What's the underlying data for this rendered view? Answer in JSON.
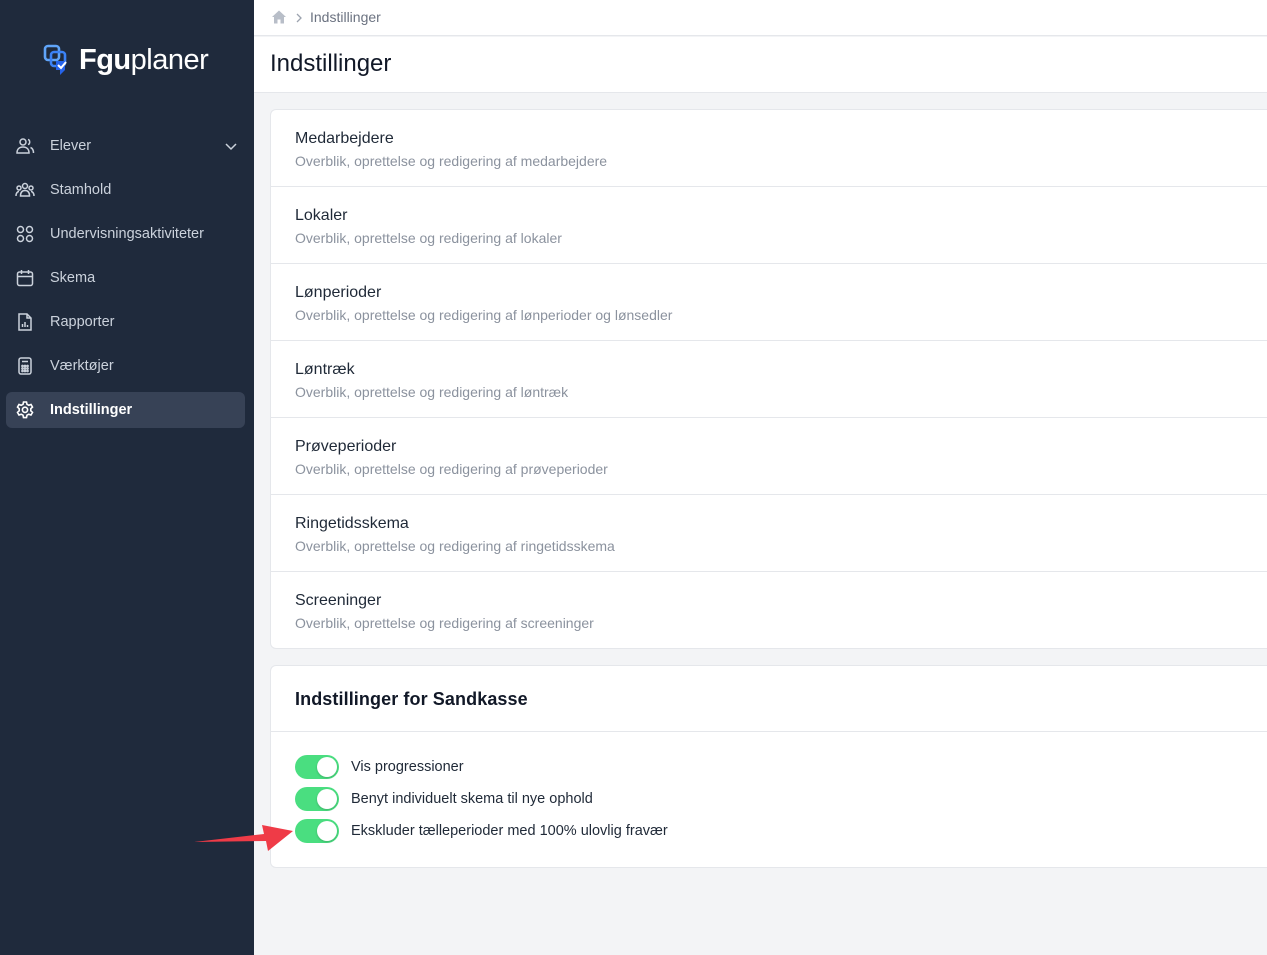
{
  "app": {
    "logo_bold": "Fgu",
    "logo_light": "planer",
    "brand_color": "#3b82f6"
  },
  "sidebar": {
    "items": [
      {
        "label": "Elever",
        "icon": "users-icon"
      },
      {
        "label": "Stamhold",
        "icon": "team-icon"
      },
      {
        "label": "Undervisningsaktiviteter",
        "icon": "grid-icon"
      },
      {
        "label": "Skema",
        "icon": "calendar-icon"
      },
      {
        "label": "Rapporter",
        "icon": "report-icon"
      },
      {
        "label": "Værktøjer",
        "icon": "calculator-icon"
      },
      {
        "label": "Indstillinger",
        "icon": "gear-icon",
        "active": true
      }
    ]
  },
  "breadcrumb": {
    "current": "Indstillinger"
  },
  "page": {
    "title": "Indstillinger"
  },
  "settings_list": [
    {
      "title": "Medarbejdere",
      "description": "Overblik, oprettelse og redigering af medarbejdere"
    },
    {
      "title": "Lokaler",
      "description": "Overblik, oprettelse og redigering af lokaler"
    },
    {
      "title": "Lønperioder",
      "description": "Overblik, oprettelse og redigering af lønperioder og lønsedler"
    },
    {
      "title": "Løntræk",
      "description": "Overblik, oprettelse og redigering af løntræk"
    },
    {
      "title": "Prøveperioder",
      "description": "Overblik, oprettelse og redigering af prøveperioder"
    },
    {
      "title": "Ringetidsskema",
      "description": "Overblik, oprettelse og redigering af ringetidsskema"
    },
    {
      "title": "Screeninger",
      "description": "Overblik, oprettelse og redigering af screeninger"
    }
  ],
  "sandbox": {
    "title": "Indstillinger for Sandkasse",
    "toggles": [
      {
        "label": "Vis progressioner",
        "enabled": true
      },
      {
        "label": "Benyt individuelt skema til nye ophold",
        "enabled": true
      },
      {
        "label": "Ekskluder tælleperioder med 100% ulovlig fravær",
        "enabled": true
      }
    ],
    "toggle_color": "#4ade80"
  },
  "annotation": {
    "arrow_color": "#ef3b47"
  }
}
